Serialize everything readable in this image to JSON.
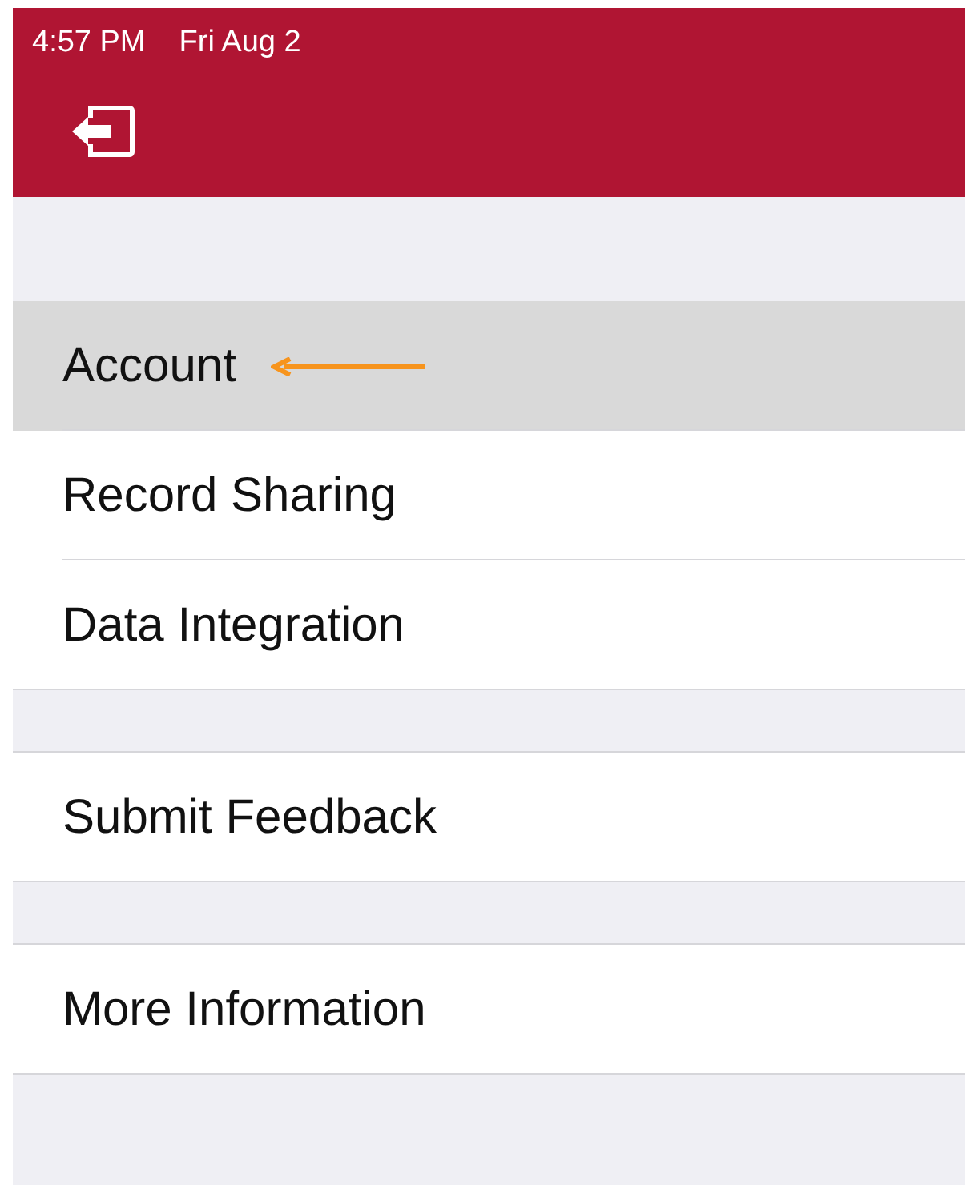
{
  "status_bar": {
    "time": "4:57 PM",
    "date": "Fri Aug 2"
  },
  "sections": [
    {
      "items": [
        {
          "label": "Account",
          "selected": true
        },
        {
          "label": "Record Sharing",
          "selected": false
        },
        {
          "label": "Data Integration",
          "selected": false
        }
      ]
    },
    {
      "items": [
        {
          "label": "Submit Feedback",
          "selected": false
        }
      ]
    },
    {
      "items": [
        {
          "label": "More Information",
          "selected": false
        }
      ]
    }
  ]
}
